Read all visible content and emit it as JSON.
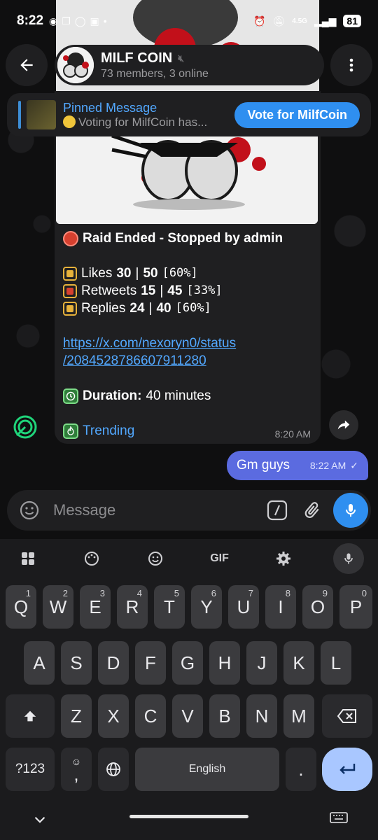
{
  "status_bar": {
    "time": "8:22",
    "network": "4.5G",
    "battery": "81"
  },
  "header": {
    "chat_name": "MILF COIN",
    "subtitle": "73 members, 3 online"
  },
  "pinned": {
    "title": "Pinned Message",
    "preview": "Voting for MilfCoin has...",
    "action": "Vote for MilfCoin"
  },
  "message": {
    "raid_title": "Raid Ended - Stopped by admin",
    "stats": [
      {
        "label": "Likes",
        "current": "30",
        "sep": "|",
        "target": "50",
        "pct": "[60%]",
        "color": "#e7b23b"
      },
      {
        "label": "Retweets",
        "current": "15",
        "sep": "|",
        "target": "45",
        "pct": "[33%]",
        "color": "#d6402f"
      },
      {
        "label": "Replies",
        "current": "24",
        "sep": "|",
        "target": "40",
        "pct": "[60%]",
        "color": "#e7b23b"
      }
    ],
    "link_line1": "https://x.com/nexoryn0/status",
    "link_line2": "/2084528786607911280",
    "duration_label": "Duration:",
    "duration_value": "40 minutes",
    "trending": "Trending",
    "time": "8:20 AM"
  },
  "outgoing": {
    "text": "Gm guys",
    "time": "8:22 AM"
  },
  "composer": {
    "placeholder": "Message"
  },
  "keyboard": {
    "toolbar": [
      "apps-icon",
      "palette-icon",
      "emoji-icon",
      "GIF",
      "settings-icon",
      "mic-icon"
    ],
    "gif_label": "GIF",
    "row1": [
      {
        "k": "Q",
        "n": "1"
      },
      {
        "k": "W",
        "n": "2"
      },
      {
        "k": "E",
        "n": "3"
      },
      {
        "k": "R",
        "n": "4"
      },
      {
        "k": "T",
        "n": "5"
      },
      {
        "k": "Y",
        "n": "6"
      },
      {
        "k": "U",
        "n": "7"
      },
      {
        "k": "I",
        "n": "8"
      },
      {
        "k": "O",
        "n": "9"
      },
      {
        "k": "P",
        "n": "0"
      }
    ],
    "row2": [
      "A",
      "S",
      "D",
      "F",
      "G",
      "H",
      "J",
      "K",
      "L"
    ],
    "row3": [
      "Z",
      "X",
      "C",
      "V",
      "B",
      "N",
      "M"
    ],
    "sym_label": "?123",
    "comma": ",",
    "space_label": "English",
    "period": "."
  }
}
